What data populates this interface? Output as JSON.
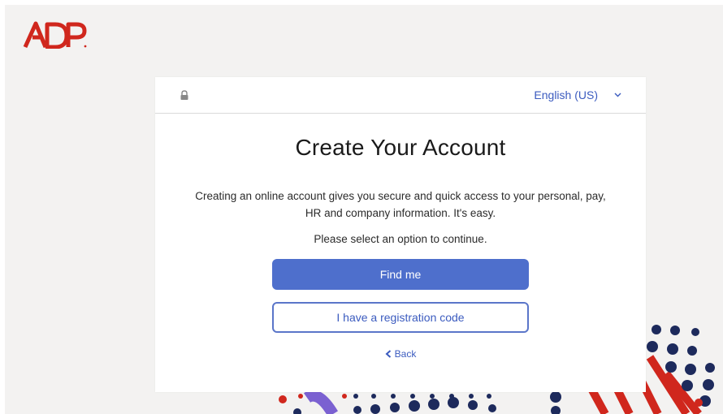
{
  "brand": {
    "logo_text": "ADP",
    "accent": "#d0271d"
  },
  "header": {
    "language": "English (US)"
  },
  "card": {
    "title": "Create Your Account",
    "description": "Creating an online account gives you secure and quick access to your personal, pay, HR and company information. It's easy.",
    "prompt": "Please select an option to continue."
  },
  "actions": {
    "find_me": "Find me",
    "registration_code": "I have a registration code",
    "back": "Back"
  },
  "colors": {
    "primary": "#4e6fcc",
    "link": "#3b5bbf",
    "navy": "#1d2a5c",
    "red": "#d0271d",
    "purple": "#7b61d1"
  },
  "icons": [
    "lock-icon",
    "chevron-down-icon",
    "chevron-left-icon",
    "adp-logo"
  ]
}
